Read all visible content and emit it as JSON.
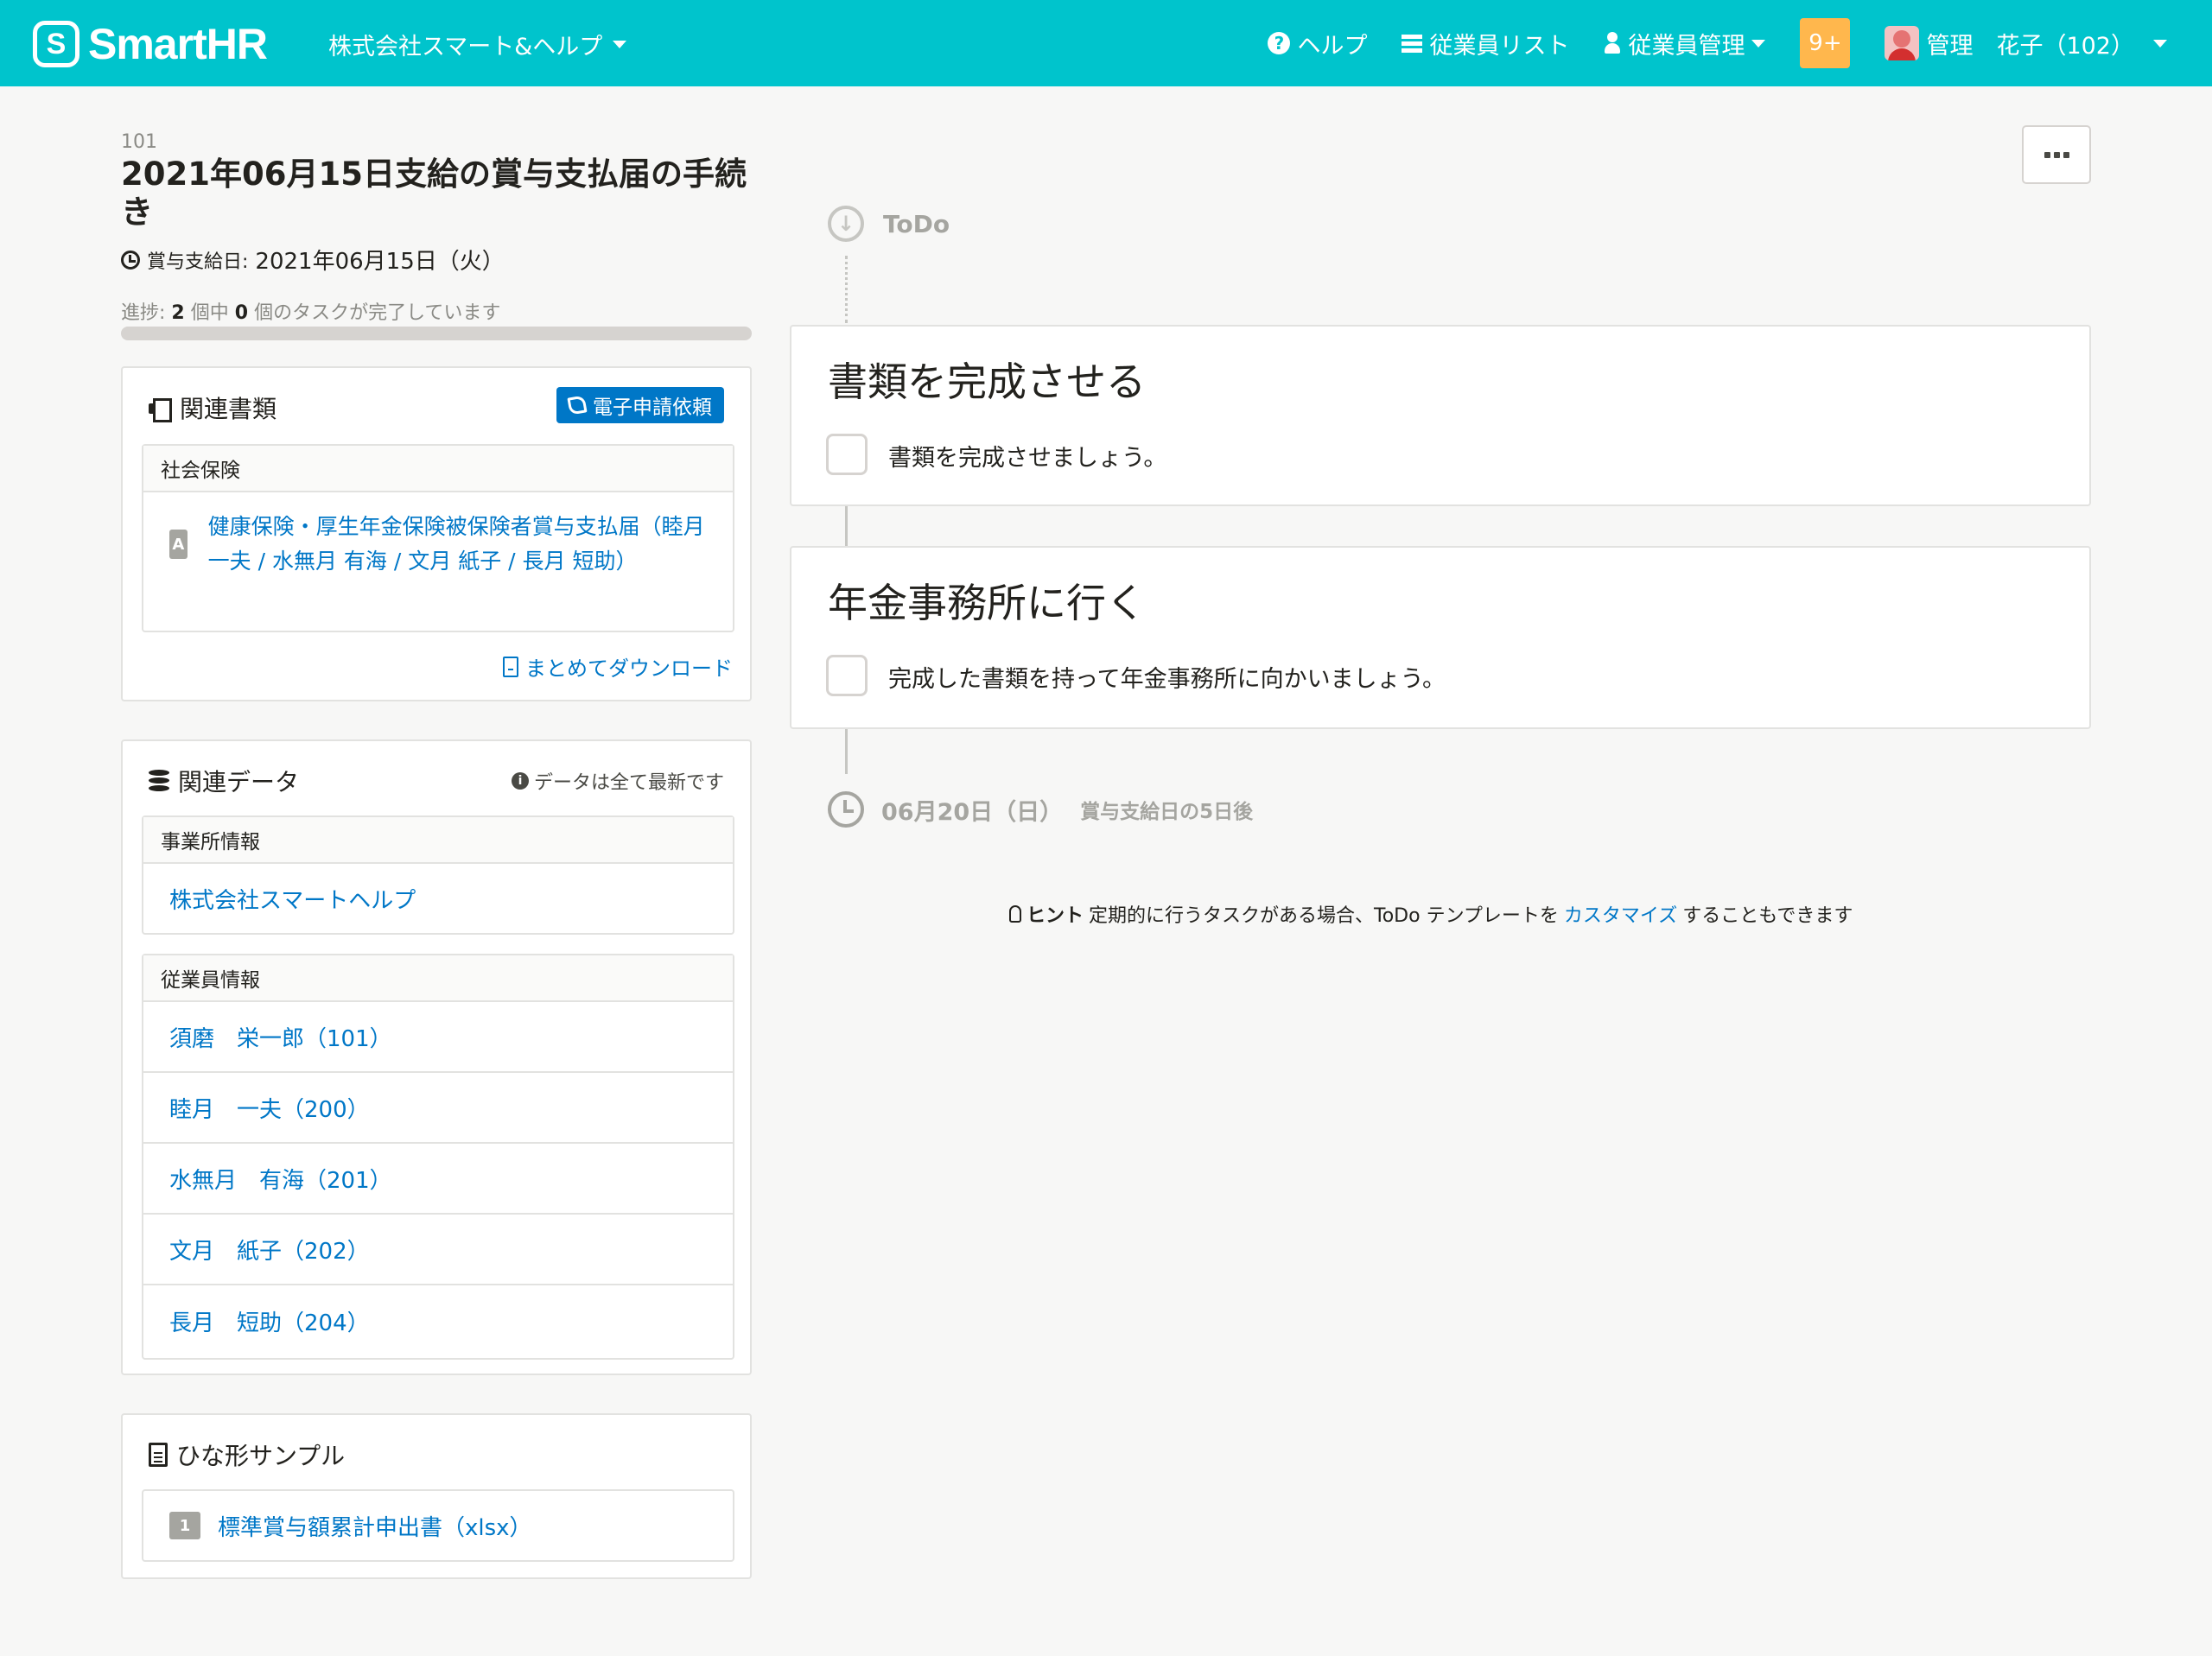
{
  "header": {
    "logo_text": "SmartHR",
    "logo_mark": "S",
    "company": "株式会社スマート&ヘルプ",
    "nav": {
      "help": "ヘルプ",
      "employee_list": "従業員リスト",
      "employee_mgmt": "従業員管理",
      "notifications": "9+",
      "user": "管理　花子（102）"
    }
  },
  "document": {
    "id": "101",
    "title": "2021年06月15日支給の賞与支払届の手続き",
    "pay_date_label": "賞与支給日:",
    "pay_date_value": "2021年06月15日（火）",
    "progress": {
      "prefix": "進捗:",
      "total": "2",
      "mid": "個中",
      "done": "0",
      "suffix": "個のタスクが完了しています",
      "fraction": 0
    }
  },
  "related_docs": {
    "title": "関連書類",
    "button": "電子申請依頼",
    "category": "社会保険",
    "item_badge": "A",
    "item_text": "健康保険・厚生年金保険被保険者賞与支払届（睦月 一夫 / 水無月 有海 / 文月 紙子 / 長月 短助）",
    "download": "まとめてダウンロード"
  },
  "related_data": {
    "title": "関連データ",
    "note": "データは全て最新です",
    "office_header": "事業所情報",
    "office": "株式会社スマートヘルプ",
    "employee_header": "従業員情報",
    "employees": [
      "須磨　栄一郎（101）",
      "睦月　一夫（200）",
      "水無月　有海（201）",
      "文月　紙子（202）",
      "長月　短助（204）"
    ]
  },
  "templates": {
    "title": "ひな形サンプル",
    "badge": "1",
    "item": "標準賞与額累計申出書（xlsx）"
  },
  "timeline": {
    "todo_label": "ToDo",
    "tasks": [
      {
        "title": "書類を完成させる",
        "description": "書類を完成させましょう。",
        "checked": false
      },
      {
        "title": "年金事務所に行く",
        "description": "完成した書類を持って年金事務所に向かいましょう。",
        "checked": false
      }
    ],
    "deadline_date": "06月20日（日）",
    "deadline_after": "賞与支給日の5日後"
  },
  "hint": {
    "label": "ヒント",
    "text1": "定期的に行うタスクがある場合、ToDo テンプレートを",
    "link": "カスタマイズ",
    "text2": "することもできます"
  },
  "colors": {
    "brand": "#00c4cc",
    "link": "#0077c7",
    "badge": "#ffb74d"
  }
}
